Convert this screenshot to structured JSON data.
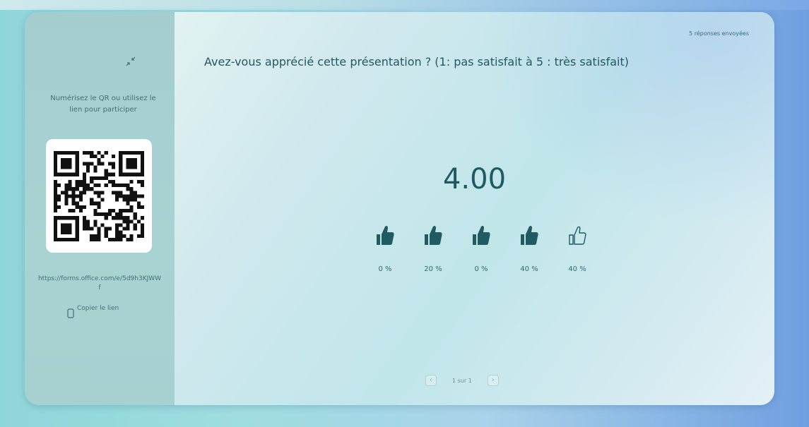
{
  "sidebar": {
    "scan_instructions": "Numérisez le QR ou utilisez le lien pour participer",
    "form_link": "https://forms.office.com/e/5d9h3KJWWf",
    "copy_link_label": "Copier le lien",
    "collapse_icon": "collapse-arrows-icon",
    "copy_icon": "copy-icon"
  },
  "main": {
    "responses_count": "5 réponses envoyées",
    "question": "Avez-vous apprécié cette présentation ? (1: pas satisfait à 5 : très satisfait)",
    "average": "4.00",
    "ratings": [
      {
        "label": "0 %",
        "filled": true
      },
      {
        "label": "20 %",
        "filled": true
      },
      {
        "label": "0 %",
        "filled": true
      },
      {
        "label": "40 %",
        "filled": true
      },
      {
        "label": "40 %",
        "filled": false
      }
    ]
  },
  "pagination": {
    "label": "1 sur 1",
    "prev_icon": "chevron-left-icon",
    "next_icon": "chevron-right-icon"
  },
  "colors": {
    "accent": "#1e5a62",
    "thumb_fill": "#1f5b60"
  }
}
